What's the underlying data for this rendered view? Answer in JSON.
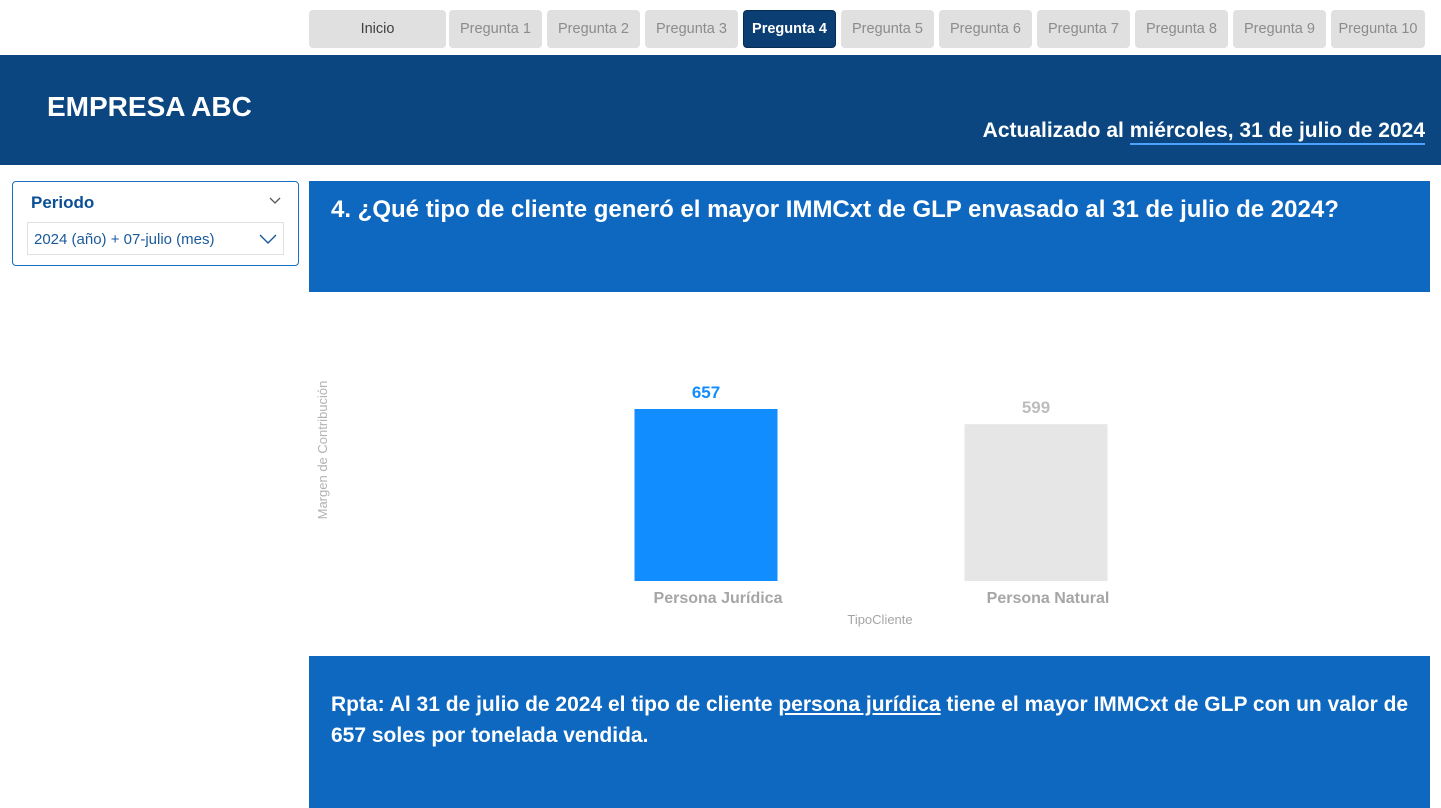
{
  "nav": {
    "items": [
      {
        "label": "Inicio",
        "active": false
      },
      {
        "label": "Pregunta 1",
        "active": false
      },
      {
        "label": "Pregunta 2",
        "active": false
      },
      {
        "label": "Pregunta 3",
        "active": false
      },
      {
        "label": "Pregunta 4",
        "active": true
      },
      {
        "label": "Pregunta 5",
        "active": false
      },
      {
        "label": "Pregunta 6",
        "active": false
      },
      {
        "label": "Pregunta 7",
        "active": false
      },
      {
        "label": "Pregunta 8",
        "active": false
      },
      {
        "label": "Pregunta 9",
        "active": false
      },
      {
        "label": "Pregunta 10",
        "active": false
      }
    ]
  },
  "header": {
    "brand": "EMPRESA ABC",
    "updated_prefix": "Actualizado al ",
    "updated_date": "miércoles, 31 de julio de 2024"
  },
  "slicer": {
    "title": "Periodo",
    "value": "2024 (año) + 07-julio (mes)"
  },
  "question": {
    "text": "4. ¿Qué tipo de cliente generó el mayor IMMCxt de GLP envasado al 31 de julio de 2024?"
  },
  "answer": {
    "prefix": "Rpta: Al 31 de julio de 2024 el tipo de cliente ",
    "highlight": "persona jurídica",
    "suffix": " tiene el mayor IMMCxt de GLP con un valor de 657 soles por tonelada vendida."
  },
  "colors": {
    "header_bg": "#0b4680",
    "panel_bg": "#0f68bf",
    "active_tab": "#0b3e72",
    "bar_highlight": "#118dff",
    "bar_muted": "#e6e6e6"
  },
  "chart_data": {
    "type": "bar",
    "categories": [
      "Persona Jurídica",
      "Persona Natural"
    ],
    "values": [
      657,
      599
    ],
    "data_labels": [
      "657",
      "599"
    ],
    "xlabel": "TipoCliente",
    "ylabel": "Margen de Contribución",
    "ylim": [
      0,
      657
    ],
    "highlighted_category": "Persona Jurídica",
    "grid": false,
    "legend": "none"
  }
}
